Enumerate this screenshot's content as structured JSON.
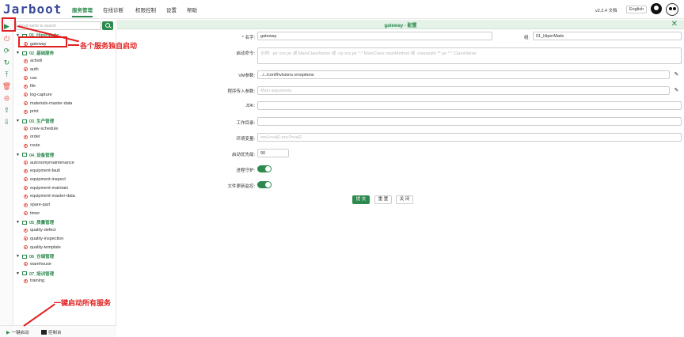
{
  "header": {
    "logo": "Jarboot",
    "nav": [
      "服务管理",
      "在线诊断",
      "权限控制",
      "设置",
      "帮助"
    ],
    "version": "v2.2.4",
    "lang_label": "文档",
    "lang_button": "English"
  },
  "tree": {
    "search_placeholder": "Input name to search",
    "groups": [
      {
        "name": "01_HiperMatic",
        "services": [
          "gateway"
        ]
      },
      {
        "name": "02_基础服务",
        "services": [
          "activiti",
          "auth",
          "cas",
          "file",
          "log-capture",
          "materials-master-data",
          "print"
        ]
      },
      {
        "name": "03_生产管理",
        "services": [
          "crew-schedule",
          "order",
          "route"
        ]
      },
      {
        "name": "04_设备管理",
        "services": [
          "autonomymaintenance",
          "equipment-fault",
          "equipment-inspect",
          "equipment-maintain",
          "equipment-master-data",
          "spare-part",
          "timer"
        ]
      },
      {
        "name": "05_质量管理",
        "services": [
          "quality-defect",
          "quality-inspection",
          "quality-template"
        ]
      },
      {
        "name": "06_仓储管理",
        "services": [
          "warehouse"
        ]
      },
      {
        "name": "07_培训管理",
        "services": [
          "training"
        ]
      }
    ]
  },
  "bottom": {
    "start_all": "一键启动",
    "console": "控制台"
  },
  "form": {
    "title": "gateway - 配置",
    "name_label": "* 名字:",
    "name_value": "gateway",
    "group_label": "组:",
    "group_value": "01_HiperMatic",
    "command_label": "启动命令:",
    "command_placeholder": "示例: -jar xxx.jar 或 MainClassName 或 -cp xxx.jar *.*.MainClass mainMethod 或 -classpath **.jar *.*.ClassName",
    "vm_label": "VM参数:",
    "vm_value": "../../conf/hvisions.vmoptions",
    "args_label": "程序传入参数:",
    "args_placeholder": "Main arguments",
    "jdk_label": "JDK:",
    "workdir_label": "工作目录:",
    "env_label": "环境变量:",
    "env_placeholder": "env1=val1;env2=val2",
    "priority_label": "启动优先级:",
    "priority_value": "90",
    "daemon_label": "进程守护:",
    "filewatch_label": "文件更新监控:",
    "submit": "提 交",
    "reset": "重 置",
    "close": "关 闭"
  },
  "annotations": {
    "per_service": "各个服务独自启动",
    "all_services": "一键启动所有服务"
  },
  "colors": {
    "accent": "#2d8a4e",
    "annotation": "#e02020"
  }
}
